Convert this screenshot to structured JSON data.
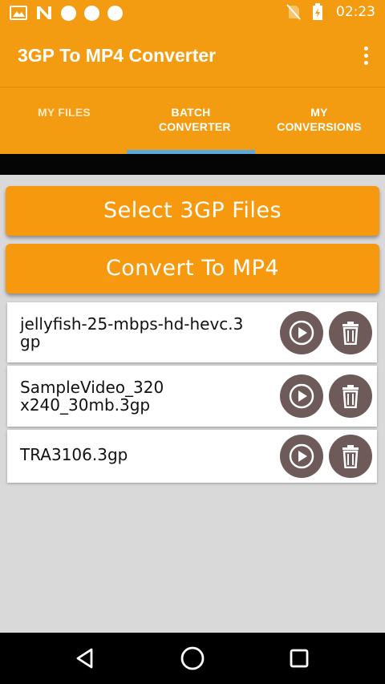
{
  "status_bar": {
    "time": "02:23",
    "left_icons": [
      "gallery-icon",
      "n-icon",
      "dot-icon",
      "dot-icon",
      "dot-icon"
    ],
    "right_icons": [
      "no-sim-icon",
      "battery-icon"
    ]
  },
  "app_bar": {
    "title": "3GP To MP4 Converter",
    "menu_icon": "more-vert-icon"
  },
  "tabs": [
    {
      "label": "MY FILES",
      "selected": false
    },
    {
      "label": "BATCH CONVERTER",
      "selected": true
    },
    {
      "label": "MY CONVERSIONS",
      "selected": false
    }
  ],
  "buttons": {
    "select": "Select 3GP Files",
    "convert": "Convert To MP4"
  },
  "files": [
    {
      "name": "jellyfish-25-mbps-hd-hevc.3gp"
    },
    {
      "name": "SampleVideo_320x240_30mb.3gp"
    },
    {
      "name": "TRA3106.3gp"
    }
  ],
  "colors": {
    "primary": "#f39c12",
    "tab_indicator": "#5aa8e0",
    "action_button_bg": "#6f5a5a",
    "background": "#d9d9d9"
  },
  "nav_bar": {
    "icons": [
      "back-icon",
      "home-icon",
      "recents-icon"
    ]
  }
}
